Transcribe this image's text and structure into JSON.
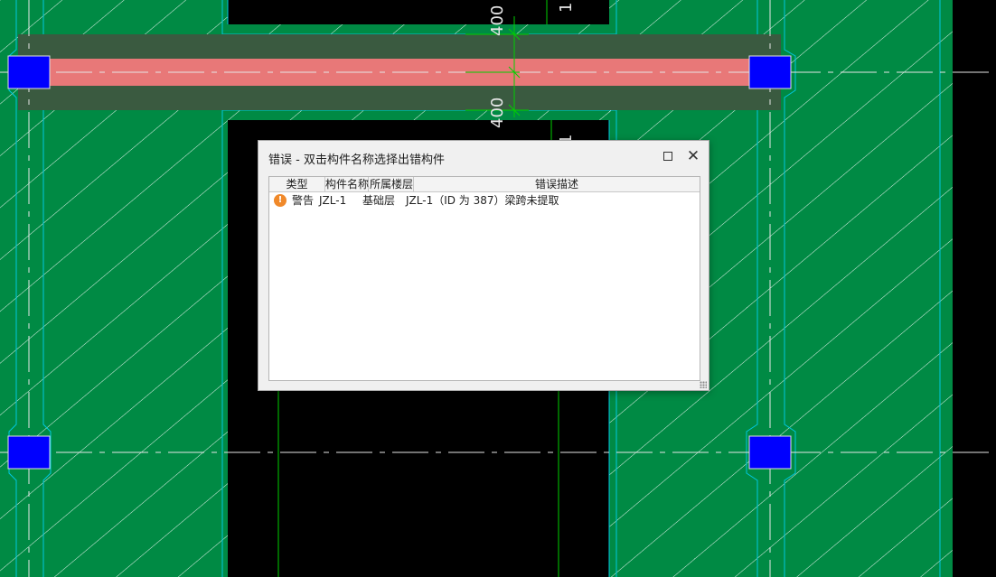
{
  "canvas": {
    "dimension_labels": [
      "400",
      "400"
    ],
    "axis_labels": [
      "1",
      "1"
    ],
    "colors": {
      "background": "#000000",
      "slab": "#008a44",
      "beam": "#e87878",
      "beam_band": "#3a5a40",
      "column": "#0000ff",
      "axis_line": "#e0e0e0",
      "dimension": "#00d000",
      "outline": "#00bcd4"
    }
  },
  "dialog": {
    "title": "错误 - 双击构件名称选择出错构件",
    "maximize_icon": "maximize-icon",
    "close_icon": "close-icon",
    "columns": [
      "类型",
      "构件名称",
      "所属楼层",
      "错误描述"
    ],
    "rows": [
      {
        "icon": "warning-icon",
        "icon_glyph": "!",
        "type": "警告",
        "name": "JZL-1",
        "floor": "基础层",
        "description": "JZL-1（ID 为 387）梁跨未提取"
      }
    ]
  }
}
